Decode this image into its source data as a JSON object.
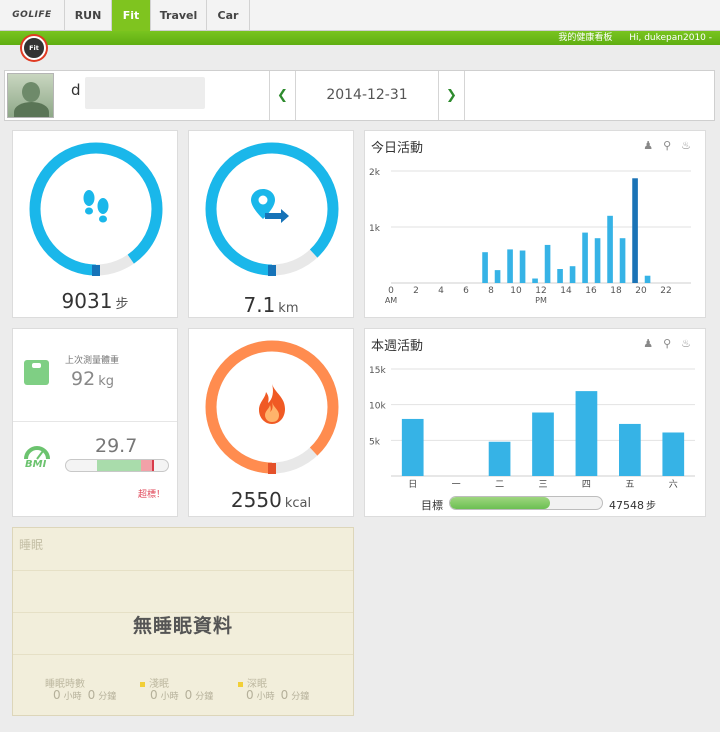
{
  "nav": {
    "tabs": [
      {
        "label": "GOLIFE"
      },
      {
        "label": "RUN"
      },
      {
        "label": "Fit"
      },
      {
        "label": "Travel"
      },
      {
        "label": "Car"
      }
    ],
    "dashboard_link": "我的健康看板",
    "user_menu": "Hi, dukepan2010 -",
    "fit_badge": "Fit"
  },
  "profile": {
    "name_initial": "d",
    "date": "2014-12-31",
    "prev_icon": "chevron-left-icon",
    "next_icon": "chevron-right-icon"
  },
  "steps": {
    "value": "9031",
    "unit": "步",
    "progress": 0.903,
    "icon": "footprints-icon",
    "color": "#1ab7ea"
  },
  "distance": {
    "value": "7.1",
    "unit": "km",
    "progress": 0.88,
    "icon": "location-arrow-icon",
    "color": "#1ab7ea"
  },
  "calories": {
    "value": "2550",
    "unit": "kcal",
    "progress": 0.88,
    "icon": "flame-icon",
    "color": "#ff8c4f"
  },
  "weight": {
    "label": "上次測量體重",
    "value": "92",
    "unit": "kg",
    "bmi_value": "29.7",
    "bmi_label": "BMI",
    "bmi_warning": "超標！"
  },
  "today": {
    "title": "今日活動",
    "icons": [
      "footprints-icon",
      "location-icon",
      "flame-icon"
    ]
  },
  "week": {
    "title": "本週活動",
    "icons": [
      "footprints-icon",
      "location-icon",
      "flame-icon"
    ],
    "goal_label": "目標",
    "goal_value": "47548",
    "goal_unit": "步",
    "goal_progress": 0.66
  },
  "sleep": {
    "title": "睡眠",
    "no_data": "無睡眠資料",
    "stats": [
      {
        "label": "睡眠時數",
        "hours": "0",
        "minutes": "0"
      },
      {
        "label": "淺眠",
        "hours": "0",
        "minutes": "0"
      },
      {
        "label": "深眠",
        "hours": "0",
        "minutes": "0"
      }
    ],
    "hour_unit": "小時",
    "minute_unit": "分鐘"
  },
  "chart_data": [
    {
      "type": "bar",
      "title": "今日活動",
      "x": [
        0,
        1,
        2,
        3,
        4,
        5,
        6,
        7,
        8,
        9,
        10,
        11,
        12,
        13,
        14,
        15,
        16,
        17,
        18,
        19,
        20,
        21,
        22,
        23
      ],
      "x_tick_labels": [
        "0",
        "2",
        "4",
        "6",
        "8",
        "10",
        "12",
        "14",
        "16",
        "18",
        "20",
        "22"
      ],
      "x_sub_labels": {
        "0": "AM",
        "12": "PM"
      },
      "values": [
        0,
        0,
        0,
        0,
        0,
        0,
        0,
        550,
        230,
        600,
        580,
        80,
        680,
        250,
        300,
        900,
        800,
        1200,
        800,
        1870,
        130,
        0,
        0,
        0
      ],
      "ylim": [
        0,
        2000
      ],
      "y_ticks": [
        "1k",
        "2k"
      ],
      "highlight_index": 19,
      "grid": true
    },
    {
      "type": "bar",
      "title": "本週活動",
      "categories": [
        "日",
        "一",
        "二",
        "三",
        "四",
        "五",
        "六"
      ],
      "values": [
        8000,
        0,
        4800,
        8900,
        11900,
        7300,
        6100
      ],
      "ylim": [
        0,
        15000
      ],
      "y_ticks": [
        "5k",
        "10k",
        "15k"
      ],
      "grid": true
    }
  ]
}
